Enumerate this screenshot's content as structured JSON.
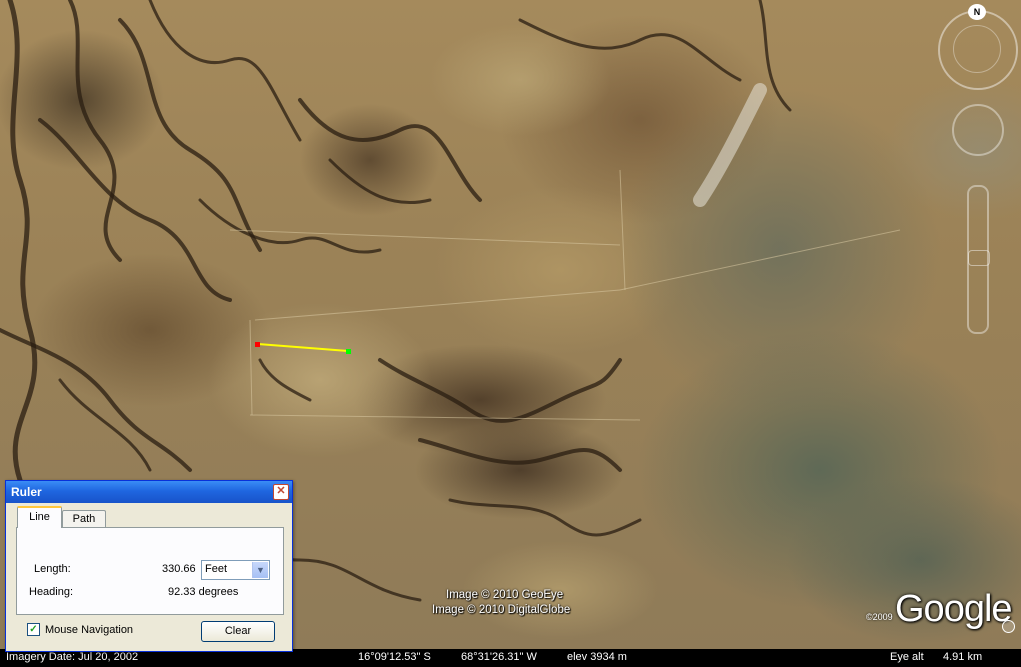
{
  "map": {
    "credits": [
      "Image © 2010 GeoEye",
      "Image © 2010 DigitalGlobe"
    ],
    "google_logo": "Google",
    "google_year": "©2009",
    "north_label": "N",
    "icons": [
      "north-compass-icon",
      "look-joystick-icon",
      "move-joystick-icon",
      "zoom-slider-icon",
      "small-compass-icon"
    ]
  },
  "status_bar": {
    "imagery_date": "Imagery Date: Jul 20, 2002",
    "latitude": "16°09'12.53\" S",
    "longitude": "68°31'26.31\" W",
    "elevation": "elev 3934 m",
    "eye_alt_label": "Eye alt",
    "eye_alt_value": "4.91 km"
  },
  "ruler": {
    "title": "Ruler",
    "tabs": [
      {
        "label": "Line"
      },
      {
        "label": "Path"
      }
    ],
    "active_tab": "Line",
    "length_label": "Length:",
    "length_value": "330.66",
    "units": "Feet",
    "heading_label": "Heading:",
    "heading_value": "92.33 degrees",
    "mouse_nav_label": "Mouse Navigation",
    "mouse_nav_checked": true,
    "check_mark": "✓",
    "clear_label": "Clear",
    "close_glyph": "✕",
    "line_colors": {
      "start": "#ff0000",
      "line": "#ffff00",
      "end": "#00ff00"
    }
  }
}
